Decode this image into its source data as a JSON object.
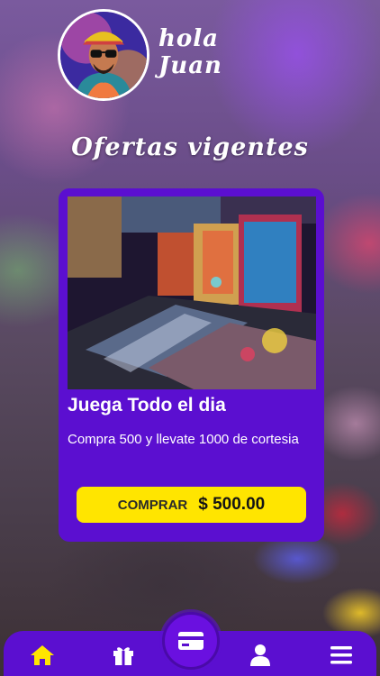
{
  "header": {
    "greeting_line1": "hola",
    "greeting_line2": "Juan",
    "avatar_icon": "user-avatar"
  },
  "section_title": "Ofertas vigentes",
  "offer": {
    "image_icon": "pinball-machines-photo",
    "title": "Juega Todo el dia",
    "description": "Compra 500 y llevate 1000 de cortesia",
    "buy_label": "COMPRAR",
    "price": "$ 500.00"
  },
  "nav": {
    "items": [
      {
        "icon": "home-icon",
        "active": true
      },
      {
        "icon": "gift-icon",
        "active": false
      },
      {
        "icon": "card-icon",
        "active": false,
        "center": true
      },
      {
        "icon": "user-icon",
        "active": false
      },
      {
        "icon": "menu-icon",
        "active": false
      }
    ]
  },
  "colors": {
    "primary": "#5b0fd0",
    "accent": "#ffe500",
    "text_light": "#ffffff"
  }
}
